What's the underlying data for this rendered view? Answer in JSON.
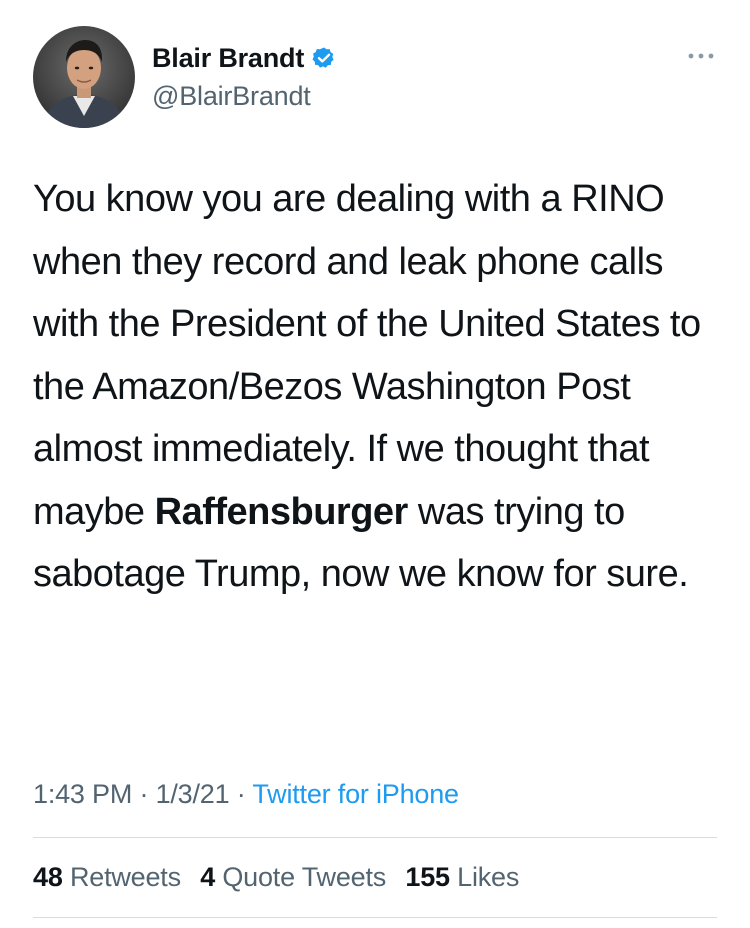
{
  "author": {
    "display_name": "Blair Brandt",
    "handle": "@BlairBrandt",
    "verified": true
  },
  "tweet": {
    "text_parts": [
      "You know you are dealing with a RINO when they record and leak phone calls with the President of the United States to the Amazon/Bezos Washington Post almost immediately. If we thought that maybe ",
      "Raffensburger",
      " was trying to sabotage Trump, now we know for sure."
    ]
  },
  "meta": {
    "time": "1:43 PM",
    "separator_1": " · ",
    "date": "1/3/21",
    "separator_2": " · ",
    "source": "Twitter for iPhone"
  },
  "stats": {
    "retweets_count": "48",
    "retweets_label": "Retweets",
    "quote_tweets_count": "4",
    "quote_tweets_label": "Quote Tweets",
    "likes_count": "155",
    "likes_label": "Likes"
  },
  "icons": {
    "verified": "verified-badge-icon",
    "more": "more-options-icon"
  },
  "colors": {
    "text": "#0f1419",
    "secondary": "#536471",
    "accent": "#1d9bf0",
    "divider": "#d6dbe0"
  }
}
